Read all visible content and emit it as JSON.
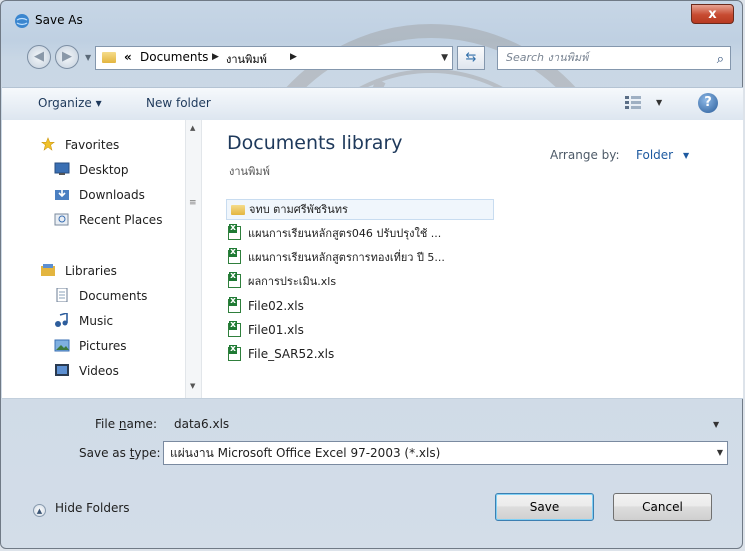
{
  "window": {
    "title": "Save As",
    "close_label": "x"
  },
  "address": {
    "overflow_marker": "«",
    "crumbs": [
      "Documents",
      "งานพิมพ์"
    ],
    "search_placeholder": "Search งานพิมพ์"
  },
  "toolbar": {
    "organize": "Organize ▾",
    "new_folder": "New folder"
  },
  "nav_pane": {
    "favorites": "Favorites",
    "desktop": "Desktop",
    "downloads": "Downloads",
    "recent": "Recent Places",
    "libraries": "Libraries",
    "documents": "Documents",
    "music": "Music",
    "pictures": "Pictures",
    "videos": "Videos"
  },
  "library": {
    "title": "Documents library",
    "subtitle": "งานพิมพ์",
    "arrange_label": "Arrange by:",
    "arrange_value": "Folder"
  },
  "files": [
    {
      "name": "จทบ ตามศรีพัชรินทร",
      "type": "folder"
    },
    {
      "name": "แผนการเรียนหลักสูตร046 ปรับปรุงใช้ ...",
      "type": "xls"
    },
    {
      "name": "แผนการเรียนหลักสูตรการทองเที่ยว ปี 5...",
      "type": "xls"
    },
    {
      "name": "ผลการประเมิน.xls",
      "type": "xls"
    },
    {
      "name": "File02.xls",
      "type": "xls"
    },
    {
      "name": "File01.xls",
      "type": "xls"
    },
    {
      "name": "File_SAR52.xls",
      "type": "xls"
    }
  ],
  "form": {
    "filename_label_pre": "File ",
    "filename_label_u": "n",
    "filename_label_post": "ame:",
    "filename_value": "data6.xls",
    "type_label_pre": "Save as ",
    "type_label_u": "t",
    "type_label_post": "ype:",
    "type_value": "แผ่นงาน Microsoft Office Excel 97-2003 (*.xls)"
  },
  "footer": {
    "hide_folders": "Hide Folders",
    "save": "Save",
    "cancel": "Cancel"
  },
  "colors": {
    "accent": "#1e5aa0",
    "title_blue": "#1e395b",
    "close_red": "#c74b31"
  }
}
